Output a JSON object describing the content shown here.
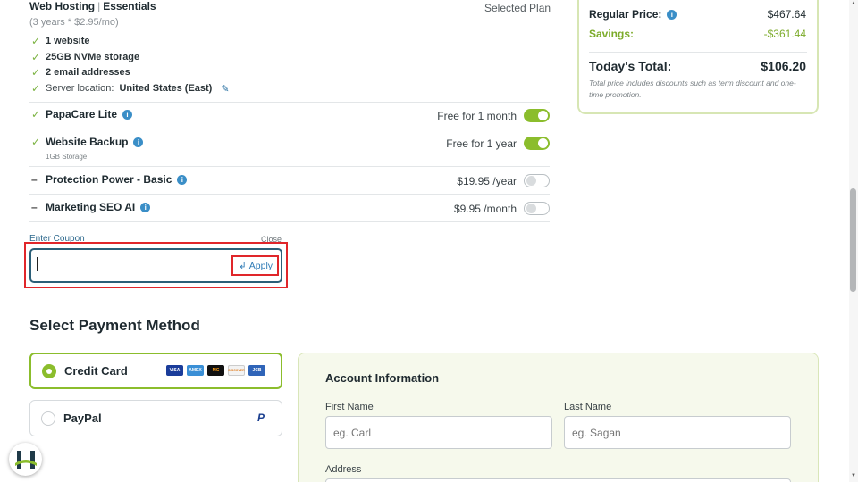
{
  "plan": {
    "title": "Web Hosting",
    "tier": "Essentials",
    "term_price": "(3 years * $2.95/mo)",
    "selected_label": "Selected Plan",
    "features": [
      {
        "text": "1 website"
      },
      {
        "text": "25GB NVMe storage"
      },
      {
        "text": "2 email addresses"
      }
    ],
    "server_location_label": "Server location:",
    "server_location_value": "United States (East)"
  },
  "addons": [
    {
      "name": "PapaCare Lite",
      "price": "Free for 1 month",
      "enabled": true
    },
    {
      "name": "Website Backup",
      "sub": "1GB Storage",
      "price": "Free for 1 year",
      "enabled": true
    },
    {
      "name": "Protection Power - Basic",
      "price": "$19.95 /year",
      "enabled": false
    },
    {
      "name": "Marketing SEO AI",
      "price": "$9.95 /month",
      "enabled": false
    }
  ],
  "coupon": {
    "label": "Enter Coupon",
    "close_label": "Close",
    "value": "",
    "apply_label": "Apply"
  },
  "payment": {
    "title": "Select Payment Method",
    "options": [
      {
        "label": "Credit Card",
        "selected": true
      },
      {
        "label": "PayPal",
        "selected": false
      }
    ],
    "card_brands": [
      "VISA",
      "AMEX",
      "MC",
      "DISCOVER",
      "JCB"
    ],
    "paypal_mark": "P"
  },
  "account": {
    "title": "Account Information",
    "first_name_label": "First Name",
    "first_name_placeholder": "eg. Carl",
    "last_name_label": "Last Name",
    "last_name_placeholder": "eg. Sagan",
    "address_label": "Address"
  },
  "summary": {
    "regular_price_label": "Regular Price:",
    "regular_price_value": "$467.64",
    "savings_label": "Savings:",
    "savings_value": "-$361.44",
    "total_label": "Today's Total:",
    "total_value": "$106.20",
    "note": "Total price includes discounts such as term discount and one-time promotion."
  },
  "colors": {
    "accent_green": "#8bbd2c",
    "link_blue": "#2f7bb6",
    "highlight_red": "#e0262a",
    "input_border": "#2b5f78"
  },
  "icons": {
    "check": "✓",
    "dash": "–",
    "info": "i",
    "pencil": "✎",
    "enter": "↲"
  }
}
